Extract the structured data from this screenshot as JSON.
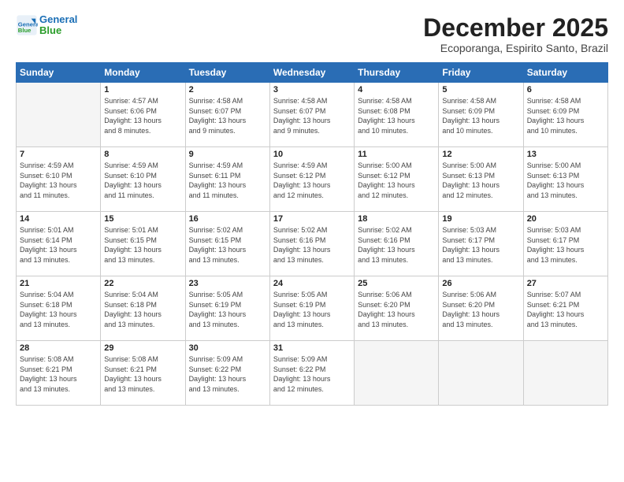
{
  "logo": {
    "line1": "General",
    "line2": "Blue"
  },
  "header": {
    "title": "December 2025",
    "location": "Ecoporanga, Espirito Santo, Brazil"
  },
  "weekdays": [
    "Sunday",
    "Monday",
    "Tuesday",
    "Wednesday",
    "Thursday",
    "Friday",
    "Saturday"
  ],
  "weeks": [
    [
      {
        "date": "",
        "info": ""
      },
      {
        "date": "1",
        "info": "Sunrise: 4:57 AM\nSunset: 6:06 PM\nDaylight: 13 hours\nand 8 minutes."
      },
      {
        "date": "2",
        "info": "Sunrise: 4:58 AM\nSunset: 6:07 PM\nDaylight: 13 hours\nand 9 minutes."
      },
      {
        "date": "3",
        "info": "Sunrise: 4:58 AM\nSunset: 6:07 PM\nDaylight: 13 hours\nand 9 minutes."
      },
      {
        "date": "4",
        "info": "Sunrise: 4:58 AM\nSunset: 6:08 PM\nDaylight: 13 hours\nand 10 minutes."
      },
      {
        "date": "5",
        "info": "Sunrise: 4:58 AM\nSunset: 6:09 PM\nDaylight: 13 hours\nand 10 minutes."
      },
      {
        "date": "6",
        "info": "Sunrise: 4:58 AM\nSunset: 6:09 PM\nDaylight: 13 hours\nand 10 minutes."
      }
    ],
    [
      {
        "date": "7",
        "info": "Sunrise: 4:59 AM\nSunset: 6:10 PM\nDaylight: 13 hours\nand 11 minutes."
      },
      {
        "date": "8",
        "info": "Sunrise: 4:59 AM\nSunset: 6:10 PM\nDaylight: 13 hours\nand 11 minutes."
      },
      {
        "date": "9",
        "info": "Sunrise: 4:59 AM\nSunset: 6:11 PM\nDaylight: 13 hours\nand 11 minutes."
      },
      {
        "date": "10",
        "info": "Sunrise: 4:59 AM\nSunset: 6:12 PM\nDaylight: 13 hours\nand 12 minutes."
      },
      {
        "date": "11",
        "info": "Sunrise: 5:00 AM\nSunset: 6:12 PM\nDaylight: 13 hours\nand 12 minutes."
      },
      {
        "date": "12",
        "info": "Sunrise: 5:00 AM\nSunset: 6:13 PM\nDaylight: 13 hours\nand 12 minutes."
      },
      {
        "date": "13",
        "info": "Sunrise: 5:00 AM\nSunset: 6:13 PM\nDaylight: 13 hours\nand 13 minutes."
      }
    ],
    [
      {
        "date": "14",
        "info": "Sunrise: 5:01 AM\nSunset: 6:14 PM\nDaylight: 13 hours\nand 13 minutes."
      },
      {
        "date": "15",
        "info": "Sunrise: 5:01 AM\nSunset: 6:15 PM\nDaylight: 13 hours\nand 13 minutes."
      },
      {
        "date": "16",
        "info": "Sunrise: 5:02 AM\nSunset: 6:15 PM\nDaylight: 13 hours\nand 13 minutes."
      },
      {
        "date": "17",
        "info": "Sunrise: 5:02 AM\nSunset: 6:16 PM\nDaylight: 13 hours\nand 13 minutes."
      },
      {
        "date": "18",
        "info": "Sunrise: 5:02 AM\nSunset: 6:16 PM\nDaylight: 13 hours\nand 13 minutes."
      },
      {
        "date": "19",
        "info": "Sunrise: 5:03 AM\nSunset: 6:17 PM\nDaylight: 13 hours\nand 13 minutes."
      },
      {
        "date": "20",
        "info": "Sunrise: 5:03 AM\nSunset: 6:17 PM\nDaylight: 13 hours\nand 13 minutes."
      }
    ],
    [
      {
        "date": "21",
        "info": "Sunrise: 5:04 AM\nSunset: 6:18 PM\nDaylight: 13 hours\nand 13 minutes."
      },
      {
        "date": "22",
        "info": "Sunrise: 5:04 AM\nSunset: 6:18 PM\nDaylight: 13 hours\nand 13 minutes."
      },
      {
        "date": "23",
        "info": "Sunrise: 5:05 AM\nSunset: 6:19 PM\nDaylight: 13 hours\nand 13 minutes."
      },
      {
        "date": "24",
        "info": "Sunrise: 5:05 AM\nSunset: 6:19 PM\nDaylight: 13 hours\nand 13 minutes."
      },
      {
        "date": "25",
        "info": "Sunrise: 5:06 AM\nSunset: 6:20 PM\nDaylight: 13 hours\nand 13 minutes."
      },
      {
        "date": "26",
        "info": "Sunrise: 5:06 AM\nSunset: 6:20 PM\nDaylight: 13 hours\nand 13 minutes."
      },
      {
        "date": "27",
        "info": "Sunrise: 5:07 AM\nSunset: 6:21 PM\nDaylight: 13 hours\nand 13 minutes."
      }
    ],
    [
      {
        "date": "28",
        "info": "Sunrise: 5:08 AM\nSunset: 6:21 PM\nDaylight: 13 hours\nand 13 minutes."
      },
      {
        "date": "29",
        "info": "Sunrise: 5:08 AM\nSunset: 6:21 PM\nDaylight: 13 hours\nand 13 minutes."
      },
      {
        "date": "30",
        "info": "Sunrise: 5:09 AM\nSunset: 6:22 PM\nDaylight: 13 hours\nand 13 minutes."
      },
      {
        "date": "31",
        "info": "Sunrise: 5:09 AM\nSunset: 6:22 PM\nDaylight: 13 hours\nand 12 minutes."
      },
      {
        "date": "",
        "info": ""
      },
      {
        "date": "",
        "info": ""
      },
      {
        "date": "",
        "info": ""
      }
    ]
  ]
}
